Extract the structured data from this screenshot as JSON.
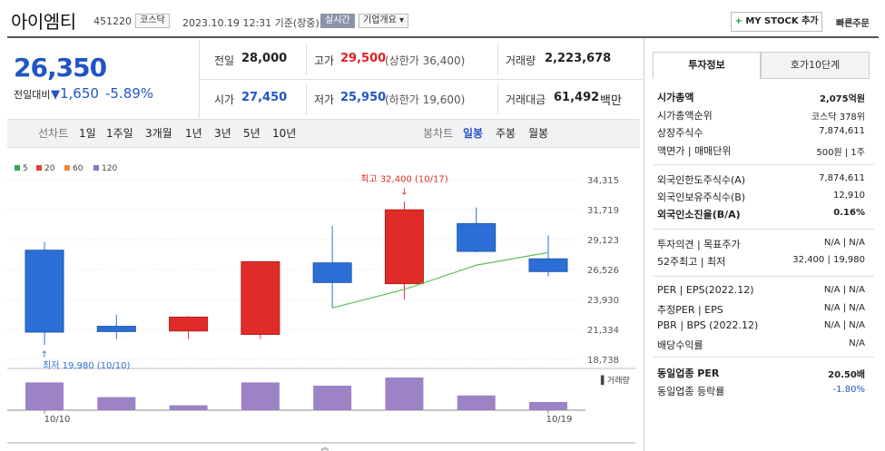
{
  "header": {
    "name": "아이엠티",
    "code": "451220",
    "market": "코스닥",
    "datetime": "2023.10.19 12:31 기준(장중)",
    "realtime": "실시간",
    "company_info": "기업개요",
    "mystock_btn": "MY STOCK 추가",
    "quick_order": "빠른주문"
  },
  "quote": {
    "price": "26,350",
    "prev_label": "전일대비",
    "change": "1,650",
    "change_pct": "-5.89%",
    "prev_close_lbl": "전일",
    "prev_close": "28,000",
    "high_lbl": "고가",
    "high": "29,500",
    "upper_limit": "(상한가 36,400)",
    "volume_lbl": "거래량",
    "volume": "2,223,678",
    "open_lbl": "시가",
    "open": "27,450",
    "low_lbl": "저가",
    "low": "25,950",
    "lower_limit": "(하한가 19,600)",
    "amount_lbl": "거래대금",
    "amount": "61,492",
    "amount_unit": "백만"
  },
  "periods": {
    "label": "선차트",
    "items": [
      "1일",
      "1주일",
      "3개월",
      "1년",
      "3년",
      "5년",
      "10년"
    ],
    "candle_label": "봉차트",
    "candle_items": [
      "일봉",
      "주봉",
      "월봉"
    ]
  },
  "legend": [
    {
      "label": "5",
      "color": "#35a853"
    },
    {
      "label": "20",
      "color": "#e0402a"
    },
    {
      "label": "60",
      "color": "#f08a2b"
    },
    {
      "label": "120",
      "color": "#9370c8"
    }
  ],
  "chart_data": {
    "type": "candlestick",
    "x_start_label": "10/10",
    "x_end_label": "10/19",
    "y_ticks": [
      "34,315",
      "31,719",
      "29,123",
      "26,526",
      "23,930",
      "21,334",
      "18,738"
    ],
    "ylim": [
      18738,
      34315
    ],
    "max_annotation": "최고 32,400 (10/17)",
    "min_annotation": "최저 19,980 (10/10)",
    "volume_label": "거래량",
    "candles": [
      {
        "open": 28200,
        "close": 21100,
        "high": 28900,
        "low": 19980,
        "volume": 0.85
      },
      {
        "open": 21600,
        "close": 21150,
        "high": 22600,
        "low": 20500,
        "volume": 0.4
      },
      {
        "open": 21200,
        "close": 22400,
        "high": 22500,
        "low": 20500,
        "volume": 0.15
      },
      {
        "open": 20900,
        "close": 27200,
        "high": 27200,
        "low": 20500,
        "volume": 0.85
      },
      {
        "open": 27100,
        "close": 25400,
        "high": 30300,
        "low": 23200,
        "volume": 0.75
      },
      {
        "open": 25300,
        "close": 31700,
        "high": 32400,
        "low": 23950,
        "volume": 1.0
      },
      {
        "open": 30500,
        "close": 28100,
        "high": 31900,
        "low": 28000,
        "volume": 0.45
      },
      {
        "open": 27450,
        "close": 26350,
        "high": 29500,
        "low": 25950,
        "volume": 0.25
      }
    ],
    "ma": [
      null,
      null,
      null,
      null,
      23200,
      24800,
      26900,
      28000
    ]
  },
  "panel": {
    "tab_active": "투자정보",
    "tab_inactive": "호가10단계",
    "rows1": [
      {
        "label": "시가총액",
        "value": "2,075억원"
      },
      {
        "label": "시가총액순위",
        "value": "코스닥 378위"
      },
      {
        "label": "상장주식수",
        "value": "7,874,611"
      },
      {
        "label": "액면가 | 매매단위",
        "value": "500원 | 1주"
      }
    ],
    "rows2": [
      {
        "label": "외국인한도주식수(A)",
        "value": "7,874,611"
      },
      {
        "label": "외국인보유주식수(B)",
        "value": "12,910"
      },
      {
        "label": "외국인소진율(B/A)",
        "value": "0.16%"
      }
    ],
    "rows3": [
      {
        "label": "투자의견 | 목표주가",
        "value": "N/A | N/A"
      },
      {
        "label": "52주최고 | 최저",
        "value": "32,400 | 19,980"
      }
    ],
    "rows4": [
      {
        "label": "PER | EPS(2022.12)",
        "value": "N/A | N/A"
      },
      {
        "label": "추정PER | EPS",
        "value": "N/A | N/A"
      },
      {
        "label": "PBR | BPS (2022.12)",
        "value": "N/A | N/A"
      },
      {
        "label": "배당수익률",
        "value": "N/A"
      }
    ],
    "rows5": [
      {
        "label": "동일업종 PER",
        "value": "20.50배"
      },
      {
        "label": "동일업종 등락률",
        "value": "-1.80%"
      }
    ]
  }
}
